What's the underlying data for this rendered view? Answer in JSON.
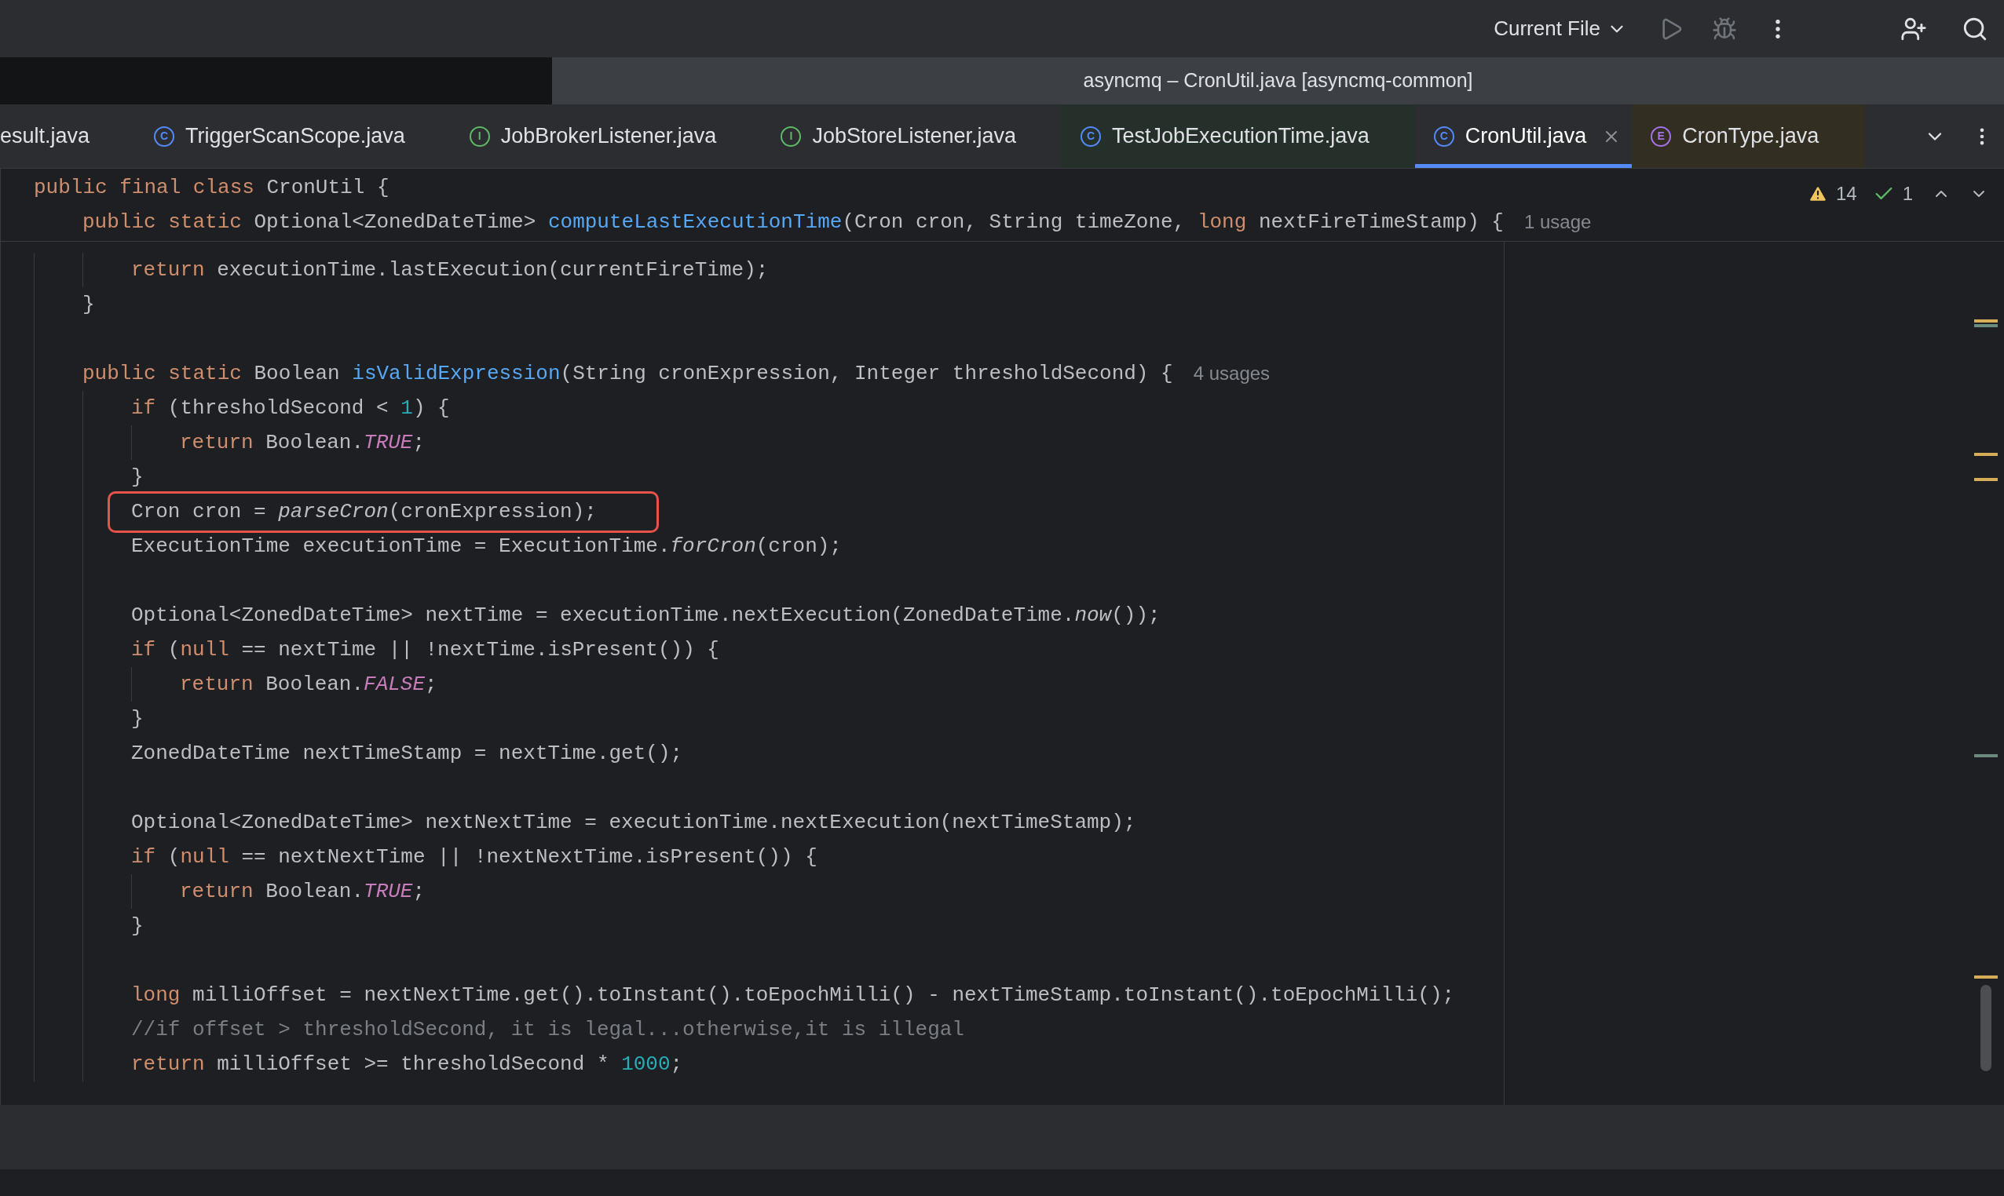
{
  "toolbar": {
    "run_config": "Current File",
    "run_enabled": false
  },
  "window": {
    "title": "asyncmq – CronUtil.java [asyncmq-common]"
  },
  "tabs": [
    {
      "label": "esult.java",
      "selected": false
    },
    {
      "label": "TriggerScanScope.java",
      "badge": "C",
      "kind": "class",
      "selected": false
    },
    {
      "label": "JobBrokerListener.java",
      "badge": "I",
      "kind": "interface",
      "selected": false
    },
    {
      "label": "JobStoreListener.java",
      "badge": "I",
      "kind": "interface",
      "selected": false
    },
    {
      "label": "TestJobExecutionTime.java",
      "badge": "C",
      "kind": "test",
      "selected": false,
      "color": "#25302a"
    },
    {
      "label": "CronUtil.java",
      "badge": "C",
      "kind": "class",
      "selected": true
    },
    {
      "label": "CronType.java",
      "badge": "E",
      "kind": "enum",
      "selected": false,
      "color": "#332e22"
    }
  ],
  "sticky_header": [
    {
      "tokens": [
        {
          "text": "public final class",
          "kind": "keyword"
        },
        {
          "text": " CronUtil {",
          "kind": "plain"
        }
      ]
    },
    {
      "tokens": [
        {
          "text": "public static",
          "kind": "keyword"
        },
        {
          "text": " Optional<ZonedDateTime> ",
          "kind": "plain"
        },
        {
          "text": "computeLastExecutionTime",
          "kind": "decl"
        },
        {
          "text": "(Cron cron, String timeZone, ",
          "kind": "plain"
        },
        {
          "text": "long",
          "kind": "keyword"
        },
        {
          "text": " nextFireTimeStamp) {",
          "kind": "plain"
        }
      ],
      "hint": "1 usage"
    }
  ],
  "inspections": {
    "warnings": "14",
    "passed": "1"
  },
  "code": [
    {
      "kind": "block",
      "children": [
        {
          "kind": "code",
          "highlighted": false,
          "tokens": [
            {
              "text": "return",
              "kind": "keyword"
            },
            {
              "text": " executionTime.lastExecution(currentFireTime);",
              "kind": "plain"
            }
          ]
        }
      ]
    },
    {
      "kind": "code",
      "highlighted": false,
      "tokens": [
        {
          "text": "}",
          "kind": "plain"
        }
      ]
    },
    {
      "kind": "blank"
    },
    {
      "kind": "code",
      "highlighted": false,
      "hint": "4 usages",
      "tokens": [
        {
          "text": "public static",
          "kind": "keyword"
        },
        {
          "text": " Boolean ",
          "kind": "plain"
        },
        {
          "text": "isValidExpression",
          "kind": "decl"
        },
        {
          "text": "(String cronExpression, Integer thresholdSecond) {",
          "kind": "plain"
        }
      ],
      "children": [
        {
          "kind": "code",
          "highlighted": false,
          "tokens": [
            {
              "text": "if",
              "kind": "keyword"
            },
            {
              "text": " (thresholdSecond < ",
              "kind": "plain"
            },
            {
              "text": "1",
              "kind": "number"
            },
            {
              "text": ") {",
              "kind": "plain"
            }
          ],
          "children": [
            {
              "kind": "code",
              "highlighted": false,
              "tokens": [
                {
                  "text": "return",
                  "kind": "keyword"
                },
                {
                  "text": " Boolean.",
                  "kind": "plain"
                },
                {
                  "text": "TRUE",
                  "kind": "constant"
                },
                {
                  "text": ";",
                  "kind": "plain"
                }
              ]
            }
          ]
        },
        {
          "kind": "code",
          "highlighted": false,
          "tokens": [
            {
              "text": "}",
              "kind": "plain"
            }
          ]
        },
        {
          "kind": "code",
          "highlighted": true,
          "tokens": [
            {
              "text": "Cron cron = ",
              "kind": "plain"
            },
            {
              "text": "parseCron",
              "kind": "static_call"
            },
            {
              "text": "(cronExpression);",
              "kind": "plain"
            }
          ]
        },
        {
          "kind": "code",
          "highlighted": false,
          "tokens": [
            {
              "text": "ExecutionTime executionTime = ExecutionTime.",
              "kind": "plain"
            },
            {
              "text": "forCron",
              "kind": "static_call"
            },
            {
              "text": "(cron);",
              "kind": "plain"
            }
          ]
        },
        {
          "kind": "blank"
        },
        {
          "kind": "code",
          "highlighted": false,
          "tokens": [
            {
              "text": "Optional<ZonedDateTime> nextTime = executionTime.nextExecution(ZonedDateTime.",
              "kind": "plain"
            },
            {
              "text": "now",
              "kind": "static_call"
            },
            {
              "text": "());",
              "kind": "plain"
            }
          ]
        },
        {
          "kind": "code",
          "highlighted": false,
          "tokens": [
            {
              "text": "if",
              "kind": "keyword"
            },
            {
              "text": " (",
              "kind": "plain"
            },
            {
              "text": "null",
              "kind": "keyword"
            },
            {
              "text": " == nextTime || !nextTime.isPresent()) {",
              "kind": "plain"
            }
          ],
          "children": [
            {
              "kind": "code",
              "highlighted": false,
              "tokens": [
                {
                  "text": "return",
                  "kind": "keyword"
                },
                {
                  "text": " Boolean.",
                  "kind": "plain"
                },
                {
                  "text": "FALSE",
                  "kind": "constant"
                },
                {
                  "text": ";",
                  "kind": "plain"
                }
              ]
            }
          ]
        },
        {
          "kind": "code",
          "highlighted": false,
          "tokens": [
            {
              "text": "}",
              "kind": "plain"
            }
          ]
        },
        {
          "kind": "code",
          "highlighted": false,
          "tokens": [
            {
              "text": "ZonedDateTime nextTimeStamp = nextTime.get();",
              "kind": "plain"
            }
          ]
        },
        {
          "kind": "blank"
        },
        {
          "kind": "code",
          "highlighted": false,
          "tokens": [
            {
              "text": "Optional<ZonedDateTime> nextNextTime = executionTime.nextExecution(nextTimeStamp);",
              "kind": "plain"
            }
          ]
        },
        {
          "kind": "code",
          "highlighted": false,
          "tokens": [
            {
              "text": "if",
              "kind": "keyword"
            },
            {
              "text": " (",
              "kind": "plain"
            },
            {
              "text": "null",
              "kind": "keyword"
            },
            {
              "text": " == nextNextTime || !nextNextTime.isPresent()) {",
              "kind": "plain"
            }
          ],
          "children": [
            {
              "kind": "code",
              "highlighted": false,
              "tokens": [
                {
                  "text": "return",
                  "kind": "keyword"
                },
                {
                  "text": " Boolean.",
                  "kind": "plain"
                },
                {
                  "text": "TRUE",
                  "kind": "constant"
                },
                {
                  "text": ";",
                  "kind": "plain"
                }
              ]
            }
          ]
        },
        {
          "kind": "code",
          "highlighted": false,
          "tokens": [
            {
              "text": "}",
              "kind": "plain"
            }
          ]
        },
        {
          "kind": "blank"
        },
        {
          "kind": "code",
          "highlighted": false,
          "tokens": [
            {
              "text": "long",
              "kind": "keyword"
            },
            {
              "text": " milliOffset = nextNextTime.get().toInstant().toEpochMilli() - nextTimeStamp.toInstant().toEpochMilli();",
              "kind": "plain"
            }
          ]
        },
        {
          "kind": "code",
          "highlighted": false,
          "tokens": [
            {
              "text": "//if offset > thresholdSecond, it is legal...otherwise,it is illegal",
              "kind": "comment"
            }
          ]
        },
        {
          "kind": "code",
          "highlighted": false,
          "tokens": [
            {
              "text": "return",
              "kind": "keyword"
            },
            {
              "text": " milliOffset >= thresholdSecond * ",
              "kind": "plain"
            },
            {
              "text": "1000",
              "kind": "number"
            },
            {
              "text": ";",
              "kind": "plain"
            }
          ]
        }
      ]
    }
  ]
}
